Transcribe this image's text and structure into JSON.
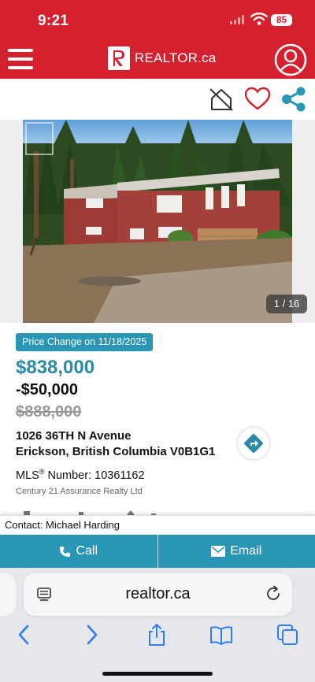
{
  "status": {
    "time": "9:21",
    "battery": "85"
  },
  "header": {
    "brand": "REALTOR.ca"
  },
  "photo": {
    "counter": "1 / 16"
  },
  "listing": {
    "price_change_badge": "Price Change on 11/18/2025",
    "price": "$838,000",
    "price_diff": "-$50,000",
    "old_price": "$888,000",
    "address_line1": "1026 36TH N Avenue",
    "address_line2": "Erickson, British Columbia V0B1G1",
    "mls_label": "MLS",
    "mls_suffix": " Number: 10361162",
    "brokerage": "Century 21 Assurance Realty Ltd"
  },
  "contact": {
    "text": "Contact: Michael Harding",
    "call_label": "Call",
    "email_label": "Email"
  },
  "browser": {
    "url": "realtor.ca"
  },
  "colors": {
    "brand_red": "#d5212e",
    "accent_teal": "#2a96b6",
    "price_teal": "#2a8aa7"
  },
  "icons": [
    "menu-icon",
    "realtor-logo",
    "profile-icon",
    "hide-listing-icon",
    "heart-icon",
    "share-icon",
    "directions-icon",
    "phone-icon",
    "mail-icon",
    "reader-icon",
    "reload-icon",
    "back-icon",
    "forward-icon",
    "share-safari-icon",
    "bookmarks-icon",
    "tabs-icon"
  ]
}
